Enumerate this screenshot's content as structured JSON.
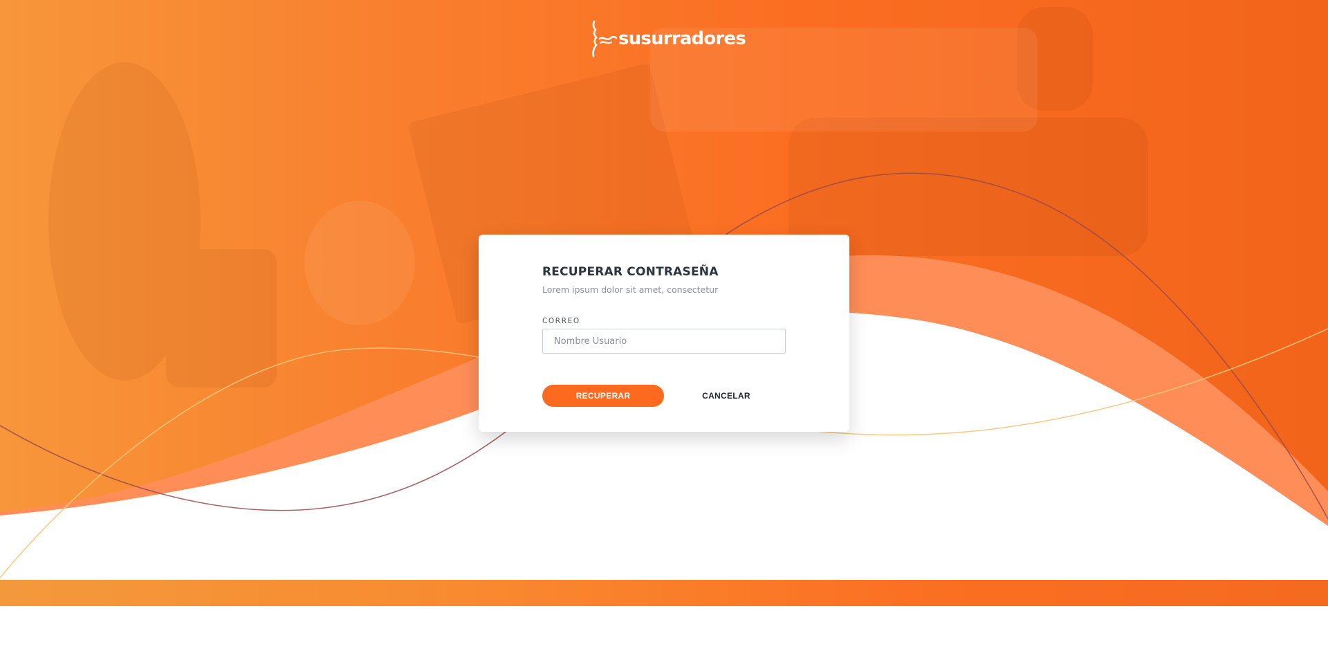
{
  "brand": {
    "name": "susurradores",
    "logo_icon": "whisper-face-icon"
  },
  "theme": {
    "primary": "#fb6a1f",
    "hero_gradient_start": "#f7963a",
    "hero_gradient_end": "#f1641a",
    "card_background": "#ffffff"
  },
  "card": {
    "title": "RECUPERAR CONTRASEÑA",
    "subtitle": "Lorem ipsum dolor sit amet, consectetur",
    "email": {
      "label": "CORREO",
      "placeholder": "Nombre Usuario",
      "value": ""
    },
    "actions": {
      "submit_label": "RECUPERAR",
      "cancel_label": "CANCELAR"
    }
  }
}
